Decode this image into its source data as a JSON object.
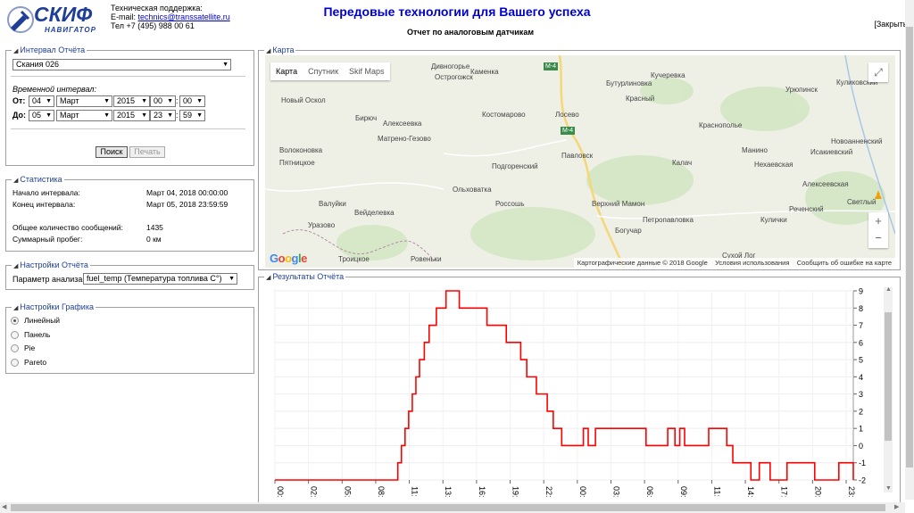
{
  "header": {
    "logo_title": "СКИФ",
    "logo_sub": "НАВИГАТОР",
    "support_label": "Техническая поддержка:",
    "email_label": "E-mail:",
    "email": "technics@transsatellite.ru",
    "phone": "Тел +7 (495) 988 00 61",
    "site_title": "Передовые технологии для Вашего успеха",
    "report_title": "Отчет по аналоговым датчикам",
    "close_label": "[Закрыть]"
  },
  "interval": {
    "legend": "Интервал Отчёта",
    "vehicle": "Скания 026",
    "time_label": "Временной интервал:",
    "from_label": "От:",
    "to_label": "До:",
    "from": {
      "day": "04",
      "month": "Март",
      "year": "2015",
      "hour": "00",
      "minute": "00"
    },
    "to": {
      "day": "05",
      "month": "Март",
      "year": "2015",
      "hour": "23",
      "minute": "59"
    },
    "search_label": "Поиск",
    "print_label": "Печать"
  },
  "stats": {
    "legend": "Статистика",
    "rows": [
      {
        "label": "Начало интервала:",
        "value": "Март 04, 2018 00:00:00"
      },
      {
        "label": "Конец интервала:",
        "value": "Март 05, 2018 23:59:59"
      },
      {
        "label": "Общее количество сообщений:",
        "value": "1435"
      },
      {
        "label": "Суммарный пробег:",
        "value": "0 км"
      }
    ]
  },
  "params": {
    "legend": "Настройки Отчёта",
    "param_label": "Параметр анализа:",
    "param_value": "fuel_temp (Температура топлива C°)"
  },
  "graph_settings": {
    "legend": "Настройки Графика",
    "options": [
      {
        "label": "Линейный",
        "selected": true
      },
      {
        "label": "Панель",
        "selected": false
      },
      {
        "label": "Pie",
        "selected": false
      },
      {
        "label": "Pareto",
        "selected": false
      }
    ]
  },
  "map": {
    "legend": "Карта",
    "tabs": [
      "Карта",
      "Спутник",
      "Skif Maps"
    ],
    "active_tab": "Карта",
    "google_logo": "Google",
    "footer": [
      "Картографические данные © 2018 Google",
      "Условия использования",
      "Сообщить об ошибке на карте"
    ],
    "zoom_in": "+",
    "zoom_out": "−",
    "fullscreen_icon": "fullscreen-icon",
    "pegman_icon": "pegman-icon",
    "roads": [
      "M-4",
      "M-4"
    ],
    "places": [
      "Дивногорье",
      "Острогожск",
      "Каменка",
      "Новый Оскол",
      "Бирюч",
      "Алексеевка",
      "Матрено-Гезово",
      "Волоконовка",
      "Пятницкое",
      "Валуйки",
      "Вейделевка",
      "Уразово",
      "Троицкое",
      "Ровеньки",
      "Костомарово",
      "Подгоренский",
      "Ольховатка",
      "Россошь",
      "Лосево",
      "Павловск",
      "Верхний Мамон",
      "Богучар",
      "Бутурлиновка",
      "Кучеревка",
      "Красный",
      "Краснополье",
      "Калач",
      "Петропавловка",
      "Манино",
      "Нехаевская",
      "Урюпинск",
      "Куликовский",
      "Новоанненский",
      "Исакиевский",
      "Алексеевская",
      "Реченский",
      "Кулички",
      "Светлый",
      "Сухой Лог"
    ]
  },
  "results": {
    "legend": "Результаты Отчёта"
  },
  "colors": {
    "line": "#ff0000",
    "brand": "#1f3f97",
    "title": "#0000cc"
  },
  "chart_data": {
    "type": "line",
    "title": "",
    "xlabel": "",
    "ylabel": "",
    "x_ticks": [
      "00:",
      "02:",
      "05:",
      "08:",
      "11:",
      "13:",
      "16:",
      "19:",
      "22:",
      "00:",
      "03:",
      "06:",
      "09:",
      "11:",
      "14:",
      "17:",
      "20:",
      "23:"
    ],
    "ylim": [
      -2,
      9
    ],
    "y_ticks": [
      9,
      8,
      7,
      6,
      5,
      4,
      3,
      2,
      1,
      0,
      -1,
      -2
    ],
    "step": true,
    "grid": true,
    "series": [
      {
        "x": [
          0,
          10.2,
          10.5,
          10.8,
          11.1,
          11.4,
          11.7,
          12.0,
          12.4,
          12.8,
          13.4,
          14.2,
          15.3,
          17.6,
          19.2,
          20.4,
          20.9,
          21.7,
          22.6,
          23.1,
          23.8,
          25.6,
          26.0,
          26.6,
          30.8,
          32.6,
          33.2,
          33.6,
          34.0,
          36.0,
          37.5,
          38.0,
          39.5,
          40.2,
          41.1,
          42.5,
          44.8,
          46.8,
          48.0
        ],
        "values": [
          -2,
          -1,
          0,
          1,
          2,
          3,
          4,
          5,
          6,
          7,
          8,
          9,
          8,
          7,
          6,
          5,
          4,
          3,
          2,
          1,
          0,
          1,
          0,
          1,
          0,
          1,
          0,
          1,
          0,
          1,
          0,
          -1,
          -2,
          -1,
          -2,
          -1,
          -2,
          -1,
          -2
        ]
      }
    ]
  }
}
